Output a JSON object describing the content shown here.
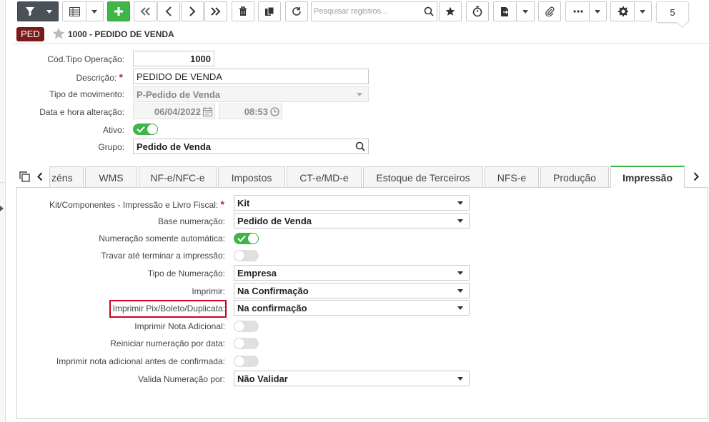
{
  "toolbar": {
    "search_placeholder": "Pesquisar registros...",
    "counter": "5",
    "buttons": [
      {
        "icon": "filter-icon"
      },
      {
        "icon": "grid-view-icon"
      },
      {
        "icon": "plus-icon"
      },
      {
        "icon": "first-record-icon"
      },
      {
        "icon": "previous-record-icon"
      },
      {
        "icon": "next-record-icon"
      },
      {
        "icon": "last-record-icon"
      },
      {
        "icon": "trash-icon"
      },
      {
        "icon": "copy-icon"
      },
      {
        "icon": "refresh-icon"
      },
      {
        "icon": "star-icon"
      },
      {
        "icon": "stopwatch-icon"
      },
      {
        "icon": "export-icon"
      },
      {
        "icon": "paperclip-icon"
      },
      {
        "icon": "more-icon"
      },
      {
        "icon": "gear-icon"
      }
    ]
  },
  "header": {
    "badge": "PED",
    "title": "1000 - PEDIDO DE VENDA"
  },
  "form": {
    "cod_tipo_operacao": {
      "label": "Cód.Tipo Operação:",
      "value": "1000"
    },
    "descricao": {
      "label": "Descrição:",
      "value": "PEDIDO DE VENDA",
      "required": "*"
    },
    "tipo_movimento": {
      "label": "Tipo de movimento:",
      "value": "P-Pedido de Venda"
    },
    "data_hora": {
      "label": "Data e hora alteração:",
      "date": "06/04/2022",
      "time": "08:53"
    },
    "ativo": {
      "label": "Ativo:",
      "on": true
    },
    "grupo": {
      "label": "Grupo:",
      "value": "Pedido de Venda"
    }
  },
  "tabs": [
    {
      "label": "zéns"
    },
    {
      "label": "WMS"
    },
    {
      "label": "NF-e/NFC-e"
    },
    {
      "label": "Impostos"
    },
    {
      "label": "CT-e/MD-e"
    },
    {
      "label": "Estoque de Terceiros"
    },
    {
      "label": "NFS-e"
    },
    {
      "label": "Produção"
    },
    {
      "label": "Impressão",
      "active": true
    }
  ],
  "impressao": {
    "kit": {
      "label": "Kit/Componentes - Impressão e Livro Fiscal:",
      "required": "*",
      "value": "Kit"
    },
    "base_numeracao": {
      "label": "Base numeração:",
      "value": "Pedido de Venda"
    },
    "num_auto": {
      "label": "Numeração somente automática:",
      "on": true
    },
    "travar": {
      "label": "Travar até terminar a impressão:",
      "on": false
    },
    "tipo_numeracao": {
      "label": "Tipo de Numeração:",
      "value": "Empresa"
    },
    "imprimir": {
      "label": "Imprimir:",
      "value": "Na Confirmação"
    },
    "pix": {
      "label": "Imprimir Pix/Boleto/Duplicata:",
      "value": "Na confirmação"
    },
    "nota_adicional": {
      "label": "Imprimir Nota Adicional:",
      "on": false
    },
    "reiniciar": {
      "label": "Reiniciar numeração por data:",
      "on": false
    },
    "nota_antes": {
      "label": "Imprimir nota adicional antes de confirmada:",
      "on": false
    },
    "valida": {
      "label": "Valida Numeração por:",
      "value": "Não Validar"
    }
  },
  "colors": {
    "accent_green": "#3fb649",
    "badge": "#7a1b1b",
    "highlight": "#d0021b",
    "toolbar_dark": "#4a5159"
  }
}
